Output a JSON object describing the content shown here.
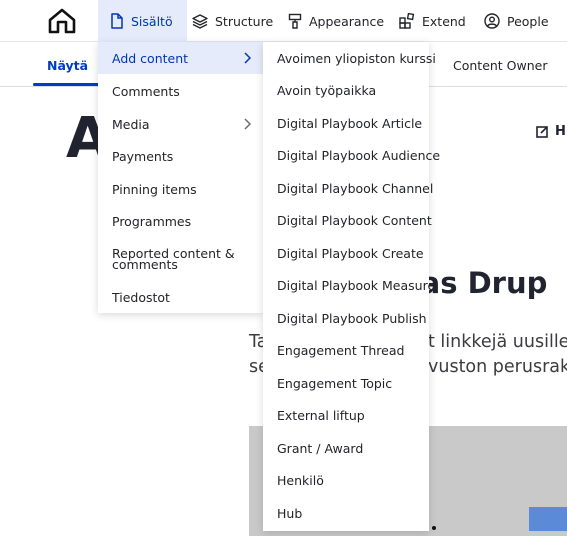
{
  "topnav": {
    "items": [
      {
        "label": "Sisältö"
      },
      {
        "label": "Structure"
      },
      {
        "label": "Appearance"
      },
      {
        "label": "Extend"
      },
      {
        "label": "People"
      }
    ]
  },
  "tabs": {
    "view": "Näytä",
    "content_owner": "Content Owner"
  },
  "page": {
    "title_fragment": "A",
    "edit_label": "H",
    "article_title_fragment": "opas Drup",
    "body_line1_left": "Ta",
    "body_line1_right": "t linkkejä uusille a",
    "body_line2_left": "se",
    "body_line2_right": "vuston perusrake"
  },
  "menu": {
    "primary": [
      {
        "label": "Add content"
      },
      {
        "label": "Comments"
      },
      {
        "label": "Media"
      },
      {
        "label": "Payments"
      },
      {
        "label": "Pinning items"
      },
      {
        "label": "Programmes"
      },
      {
        "label": "Reported content & comments"
      },
      {
        "label": "Tiedostot"
      }
    ],
    "add_content": [
      {
        "label": "Avoimen yliopiston kurssi"
      },
      {
        "label": "Avoin työpaikka"
      },
      {
        "label": "Digital Playbook Article"
      },
      {
        "label": "Digital Playbook Audience"
      },
      {
        "label": "Digital Playbook Channel"
      },
      {
        "label": "Digital Playbook Content"
      },
      {
        "label": "Digital Playbook Create"
      },
      {
        "label": "Digital Playbook Measure"
      },
      {
        "label": "Digital Playbook Publish"
      },
      {
        "label": "Engagement Thread"
      },
      {
        "label": "Engagement Topic"
      },
      {
        "label": "External liftup"
      },
      {
        "label": "Grant / Award"
      },
      {
        "label": "Henkilö"
      },
      {
        "label": "Hub"
      }
    ]
  },
  "colors": {
    "accent": "#003cc5",
    "active_bg": "#e6ebfb"
  }
}
